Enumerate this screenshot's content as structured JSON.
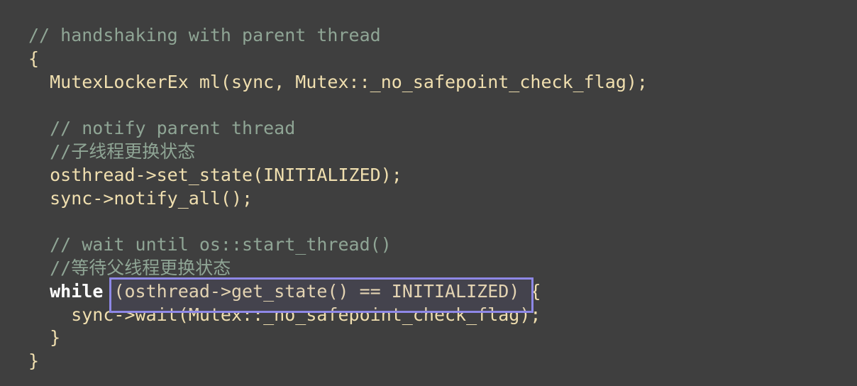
{
  "code": {
    "line1": "// handshaking with parent thread",
    "line2": "{",
    "line3": "  MutexLockerEx ml(sync, Mutex::_no_safepoint_check_flag);",
    "line4": "",
    "line5": "  // notify parent thread",
    "line6": "  //子线程更换状态",
    "line7": "  osthread->set_state(INITIALIZED);",
    "line8": "  sync->notify_all();",
    "line9": "",
    "line10": "  // wait until os::start_thread()",
    "line11": "  //等待父线程更换状态",
    "line12_indent": "  ",
    "line12_keyword": "while",
    "line12_space": " ",
    "line12_highlight": "(osthread->get_state() == INITIALIZED)",
    "line12_tail": " {",
    "line13": "    sync->wait(Mutex::_no_safepoint_check_flag);",
    "line14": "  }",
    "line15": "}"
  },
  "colors": {
    "background": "#3f3f3f",
    "comment": "#8fa595",
    "code": "#f0dfaf",
    "keyword": "#ffffff",
    "highlight_border": "#8e88e6"
  }
}
